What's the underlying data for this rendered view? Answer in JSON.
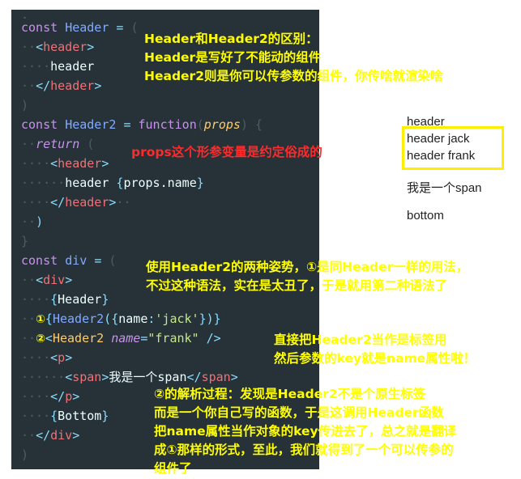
{
  "code_lines": [
    "const Header = (",
    "  <header>",
    "    header",
    "  </header>",
    ")",
    "const Header2 = function(props) {",
    "  return (",
    "    <header>",
    "      header {props.name}",
    "    </header>",
    "  )",
    "}",
    "const div = (",
    "  <div>",
    "    {Header}",
    "    ①{Header2({name:'jack'})}",
    "    ②<Header2 name=\"frank\" />",
    "    <p>",
    "      <span>我是一个span</span>",
    "    </p>",
    "    {Bottom}",
    "  </div>",
    ")"
  ],
  "annotations": {
    "diff_title": "Header和Header2的区别：",
    "diff_line1": "Header是写好了不能动的组件",
    "diff_line2": "Header2则是你可以传参数的组件，你传啥就渲染啥",
    "props_note": "props这个形参变量是约定俗成的",
    "usage_line1": "使用Header2的两种姿势，①是同Header一样的用法，",
    "usage_line2": "不过这种语法，实在是太丑了，于是就用第二种语法了",
    "tag_line1": "直接把Header2当作是标签用",
    "tag_line2": "然后参数的key就是name属性啦！",
    "parse_line1": "②的解析过程：发现是Header2不是个原生标签",
    "parse_line2": "而是一个你自己写的函数，于是这调用Header函数",
    "parse_line3": "把name属性当作对象的key传进去了，总之就是翻译",
    "parse_line4": "成①那样的形式，至此，我们就得到了一个可以传参的",
    "parse_line5": "组件了"
  },
  "output": {
    "line1": "header",
    "line2": "header jack",
    "line3": "header frank",
    "line4": "我是一个span",
    "line5": "bottom"
  },
  "colors": {
    "editor_bg": "#263238",
    "annotation_yellow": "#ffff00",
    "annotation_red": "#ff2a2a",
    "highlight_box": "#ffee00"
  }
}
